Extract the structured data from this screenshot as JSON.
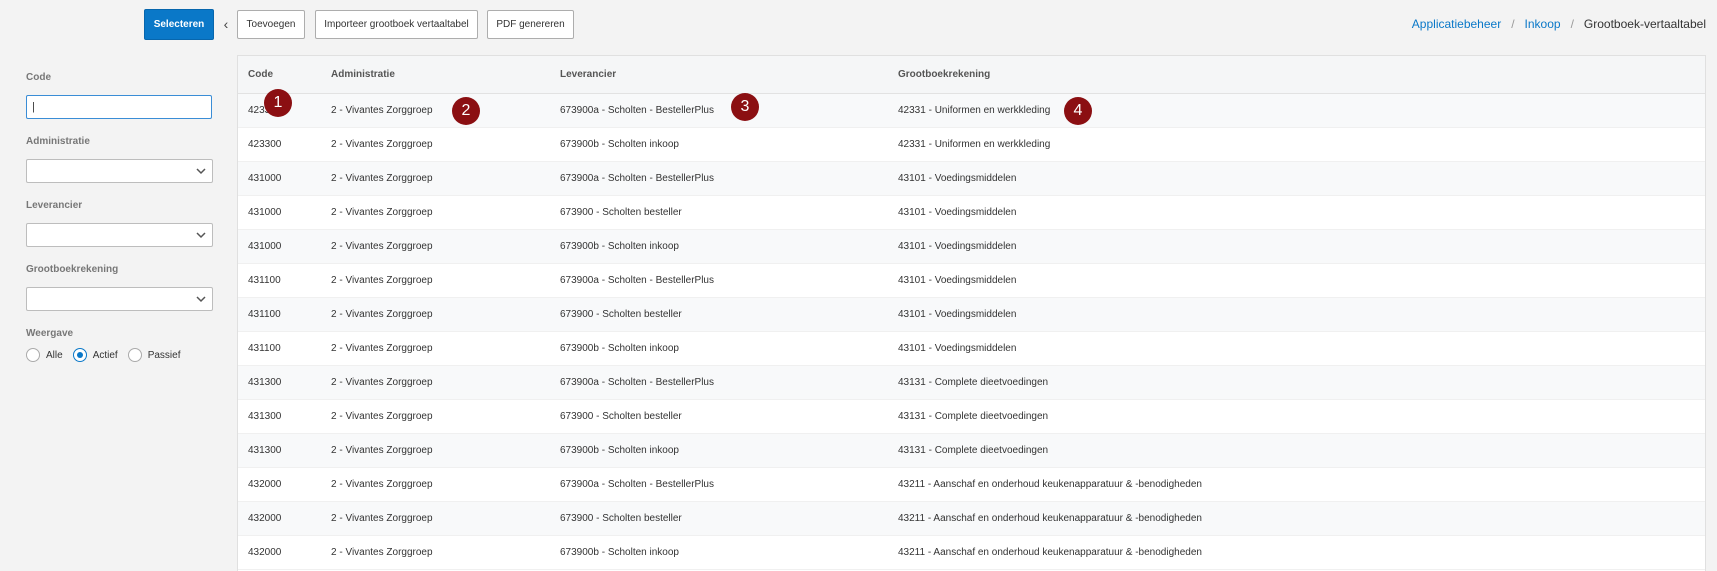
{
  "toolbar": {
    "select_label": "Selecteren",
    "add_label": "Toevoegen",
    "import_label": "Importeer grootboek vertaaltabel",
    "pdf_label": "PDF genereren",
    "collapse_glyph": "‹"
  },
  "breadcrumb": {
    "item1": "Applicatiebeheer",
    "item2": "Inkoop",
    "current": "Grootboek-vertaaltabel",
    "separator": "/"
  },
  "filters": {
    "code_label": "Code",
    "code_value": "|",
    "administratie_label": "Administratie",
    "leverancier_label": "Leverancier",
    "grootboek_label": "Grootboekrekening",
    "weergave_label": "Weergave",
    "radio_alle": "Alle",
    "radio_actief": "Actief",
    "radio_passief": "Passief"
  },
  "table": {
    "headers": {
      "code": "Code",
      "administratie": "Administratie",
      "leverancier": "Leverancier",
      "grootboek": "Grootboekrekening"
    },
    "rows": [
      {
        "code": "423300",
        "adm": "2 - Vivantes Zorggroep",
        "lev": "673900a - Scholten - BestellerPlus",
        "gb": "42331 - Uniformen en werkkleding"
      },
      {
        "code": "423300",
        "adm": "2 - Vivantes Zorggroep",
        "lev": "673900b - Scholten inkoop",
        "gb": "42331 - Uniformen en werkkleding"
      },
      {
        "code": "431000",
        "adm": "2 - Vivantes Zorggroep",
        "lev": "673900a - Scholten - BestellerPlus",
        "gb": "43101 - Voedingsmiddelen"
      },
      {
        "code": "431000",
        "adm": "2 - Vivantes Zorggroep",
        "lev": "673900 - Scholten besteller",
        "gb": "43101 - Voedingsmiddelen"
      },
      {
        "code": "431000",
        "adm": "2 - Vivantes Zorggroep",
        "lev": "673900b - Scholten inkoop",
        "gb": "43101 - Voedingsmiddelen"
      },
      {
        "code": "431100",
        "adm": "2 - Vivantes Zorggroep",
        "lev": "673900a - Scholten - BestellerPlus",
        "gb": "43101 - Voedingsmiddelen"
      },
      {
        "code": "431100",
        "adm": "2 - Vivantes Zorggroep",
        "lev": "673900 - Scholten besteller",
        "gb": "43101 - Voedingsmiddelen"
      },
      {
        "code": "431100",
        "adm": "2 - Vivantes Zorggroep",
        "lev": "673900b - Scholten inkoop",
        "gb": "43101 - Voedingsmiddelen"
      },
      {
        "code": "431300",
        "adm": "2 - Vivantes Zorggroep",
        "lev": "673900a - Scholten - BestellerPlus",
        "gb": "43131 - Complete dieetvoedingen"
      },
      {
        "code": "431300",
        "adm": "2 - Vivantes Zorggroep",
        "lev": "673900 - Scholten besteller",
        "gb": "43131 - Complete dieetvoedingen"
      },
      {
        "code": "431300",
        "adm": "2 - Vivantes Zorggroep",
        "lev": "673900b - Scholten inkoop",
        "gb": "43131 - Complete dieetvoedingen"
      },
      {
        "code": "432000",
        "adm": "2 - Vivantes Zorggroep",
        "lev": "673900a - Scholten - BestellerPlus",
        "gb": "43211 - Aanschaf en onderhoud keukenapparatuur & -benodigheden"
      },
      {
        "code": "432000",
        "adm": "2 - Vivantes Zorggroep",
        "lev": "673900 - Scholten besteller",
        "gb": "43211 - Aanschaf en onderhoud keukenapparatuur & -benodigheden"
      },
      {
        "code": "432000",
        "adm": "2 - Vivantes Zorggroep",
        "lev": "673900b - Scholten inkoop",
        "gb": "43211 - Aanschaf en onderhoud keukenapparatuur & -benodigheden"
      }
    ]
  },
  "markers": [
    "1",
    "2",
    "3",
    "4"
  ],
  "colors": {
    "primary": "#0a78c8",
    "marker": "#8b0f12"
  }
}
